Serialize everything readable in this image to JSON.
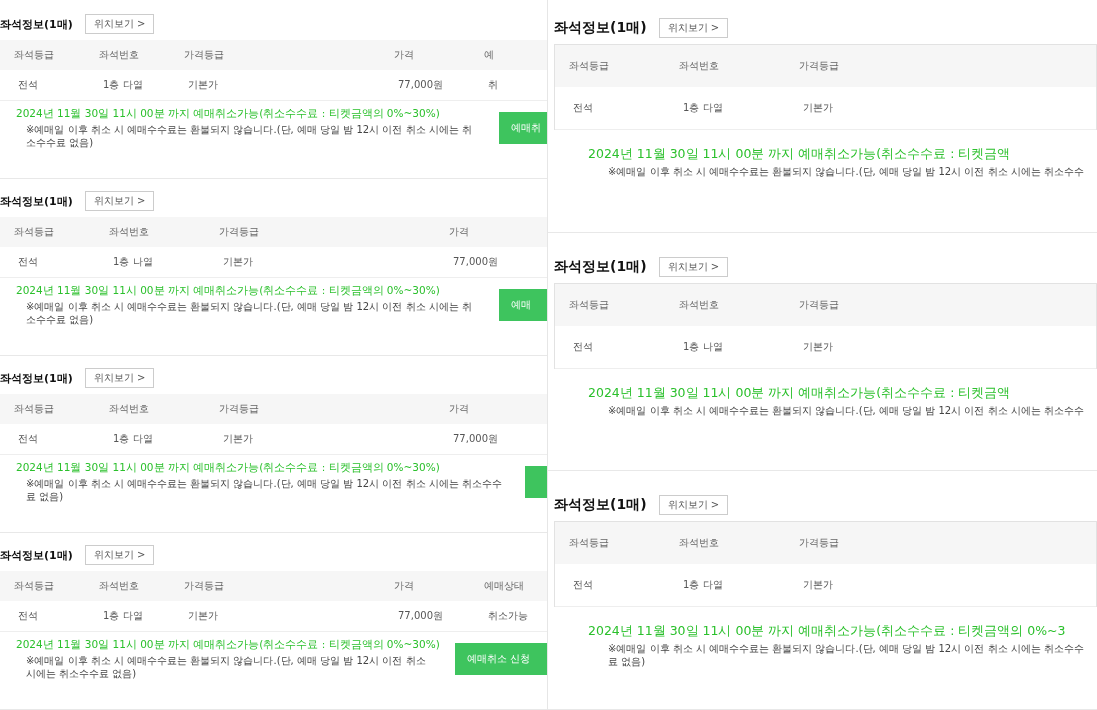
{
  "left_panels": [
    {
      "title": "좌석정보(1매)",
      "location_button": "위치보기 >",
      "columns": [
        "좌석등급",
        "좌석번호",
        "가격등급",
        "가격",
        "예"
      ],
      "cells": [
        "전석",
        "1층 다열",
        "기본가",
        "77,000원",
        "취"
      ],
      "notice": "2024년 11월 30일 11시 00분 까지 예매취소가능(취소수수료 : 티켓금액의 0%~30%)",
      "note": "※예매일 이후 취소 시 예매수수료는 환불되지 않습니다.(단, 예매 당일 밤 12시 이전 취소 시에는 취소수수료 없음)",
      "cancel_button": "예매취"
    },
    {
      "title": "좌석정보(1매)",
      "location_button": "위치보기 >",
      "columns": [
        "좌석등급",
        "좌석번호",
        "가격등급",
        "가격"
      ],
      "cells": [
        "전석",
        "1층 나열",
        "기본가",
        "77,000원"
      ],
      "notice": "2024년 11월 30일 11시 00분 까지 예매취소가능(취소수수료 : 티켓금액의 0%~30%)",
      "note": "※예매일 이후 취소 시 예매수수료는 환불되지 않습니다.(단, 예매 당일 밤 12시 이전 취소 시에는 취소수수료 없음)",
      "cancel_button": "예매"
    },
    {
      "title": "좌석정보(1매)",
      "location_button": "위치보기 >",
      "columns": [
        "좌석등급",
        "좌석번호",
        "가격등급",
        "가격"
      ],
      "cells": [
        "전석",
        "1층 다열",
        "기본가",
        "77,000원"
      ],
      "notice": "2024년 11월 30일 11시 00분 까지 예매취소가능(취소수수료 : 티켓금액의 0%~30%)",
      "note": "※예매일 이후 취소 시 예매수수료는 환불되지 않습니다.(단, 예매 당일 밤 12시 이전 취소 시에는 취소수수료 없음)"
    },
    {
      "title": "좌석정보(1매)",
      "location_button": "위치보기 >",
      "columns": [
        "좌석등급",
        "좌석번호",
        "가격등급",
        "가격",
        "예매상태"
      ],
      "cells": [
        "전석",
        "1층 다열",
        "기본가",
        "77,000원",
        "취소가능"
      ],
      "notice": "2024년 11월 30일 11시 00분 까지 예매취소가능(취소수수료 : 티켓금액의 0%~30%)",
      "note": "※예매일 이후 취소 시 예매수수료는 환불되지 않습니다.(단, 예매 당일 밤 12시 이전 취소 시에는 취소수수료 없음)",
      "cancel_button": "예매취소 신청"
    }
  ],
  "right_panels": [
    {
      "title": "좌석정보(1매)",
      "location_button": "위치보기 >",
      "columns": [
        "좌석등급",
        "좌석번호",
        "가격등급"
      ],
      "cells": [
        "전석",
        "1층 다열",
        "기본가"
      ],
      "notice": "2024년 11월 30일 11시 00분 까지 예매취소가능(취소수수료 : 티켓금액",
      "note": "※예매일 이후 취소 시 예매수수료는 환불되지 않습니다.(단, 예매 당일 밤 12시 이전 취소 시에는 취소수수"
    },
    {
      "title": "좌석정보(1매)",
      "location_button": "위치보기 >",
      "columns": [
        "좌석등급",
        "좌석번호",
        "가격등급"
      ],
      "cells": [
        "전석",
        "1층 나열",
        "기본가"
      ],
      "notice": "2024년 11월 30일 11시 00분 까지 예매취소가능(취소수수료 : 티켓금액",
      "note": "※예매일 이후 취소 시 예매수수료는 환불되지 않습니다.(단, 예매 당일 밤 12시 이전 취소 시에는 취소수수"
    },
    {
      "title": "좌석정보(1매)",
      "location_button": "위치보기 >",
      "columns": [
        "좌석등급",
        "좌석번호",
        "가격등급"
      ],
      "cells": [
        "전석",
        "1층 다열",
        "기본가"
      ],
      "notice": "2024년 11월 30일 11시 00분 까지 예매취소가능(취소수수료 : 티켓금액의 0%~3",
      "note": "※예매일 이후 취소 시 예매수수료는 환불되지 않습니다.(단, 예매 당일 밤 12시 이전 취소 시에는 취소수수료 없음)"
    }
  ]
}
